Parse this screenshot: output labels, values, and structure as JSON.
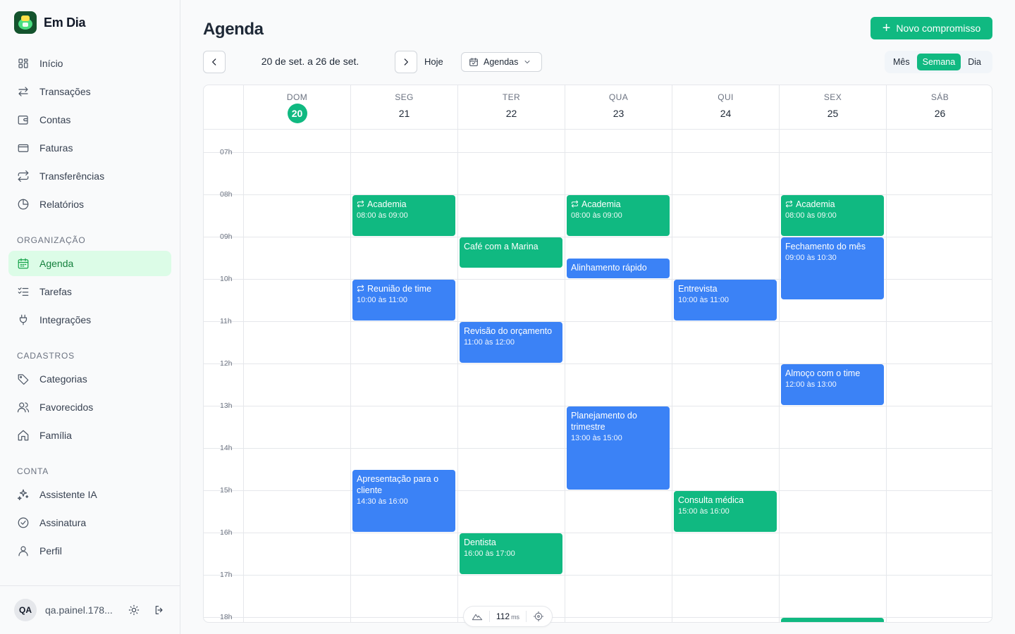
{
  "app": {
    "name": "Em Dia"
  },
  "sidebar": {
    "main_items": [
      {
        "label": "Início",
        "icon": "grid-icon"
      },
      {
        "label": "Transações",
        "icon": "arrows-left-right-icon"
      },
      {
        "label": "Contas",
        "icon": "wallet-icon"
      },
      {
        "label": "Faturas",
        "icon": "credit-card-icon"
      },
      {
        "label": "Transferências",
        "icon": "repeat-icon"
      },
      {
        "label": "Relatórios",
        "icon": "pie-chart-icon"
      }
    ],
    "sections": [
      {
        "label": "Organização",
        "items": [
          {
            "label": "Agenda",
            "icon": "calendar-icon",
            "active": true
          },
          {
            "label": "Tarefas",
            "icon": "list-checks-icon"
          },
          {
            "label": "Integrações",
            "icon": "plug-icon"
          }
        ]
      },
      {
        "label": "Cadastros",
        "items": [
          {
            "label": "Categorias",
            "icon": "tag-icon"
          },
          {
            "label": "Favorecidos",
            "icon": "users-icon"
          },
          {
            "label": "Família",
            "icon": "home-icon"
          }
        ]
      },
      {
        "label": "Conta",
        "items": [
          {
            "label": "Assistente IA",
            "icon": "sparkles-icon"
          },
          {
            "label": "Assinatura",
            "icon": "check-circle-icon"
          },
          {
            "label": "Perfil",
            "icon": "user-icon"
          }
        ]
      }
    ],
    "user": {
      "initials": "QA",
      "email": "qa.painel.178..."
    }
  },
  "header": {
    "title": "Agenda",
    "new_button": "Novo compromisso",
    "date_range": "20 de set. a 26 de set.",
    "today": "Hoje",
    "calendars_filter": "Agendas",
    "views": [
      {
        "label": "Mês",
        "active": false
      },
      {
        "label": "Semana",
        "active": true
      },
      {
        "label": "Dia",
        "active": false
      }
    ]
  },
  "calendar": {
    "days": [
      {
        "dow": "DOM",
        "num": "20",
        "today": true
      },
      {
        "dow": "SEG",
        "num": "21"
      },
      {
        "dow": "TER",
        "num": "22"
      },
      {
        "dow": "QUA",
        "num": "23"
      },
      {
        "dow": "QUI",
        "num": "24"
      },
      {
        "dow": "SEX",
        "num": "25"
      },
      {
        "dow": "SÁB",
        "num": "26"
      }
    ],
    "hours": [
      "07h",
      "08h",
      "09h",
      "10h",
      "11h",
      "12h",
      "13h",
      "14h",
      "15h",
      "16h",
      "17h",
      "18h"
    ],
    "events": [
      {
        "day": 1,
        "title": "Academia",
        "time": "08:00 às 09:00",
        "start": 8,
        "end": 9,
        "color": "green",
        "recurring": true
      },
      {
        "day": 3,
        "title": "Academia",
        "time": "08:00 às 09:00",
        "start": 8,
        "end": 9,
        "color": "green",
        "recurring": true
      },
      {
        "day": 5,
        "title": "Academia",
        "time": "08:00 às 09:00",
        "start": 8,
        "end": 9,
        "color": "green",
        "recurring": true
      },
      {
        "day": 2,
        "title": "Café com a Marina",
        "time": "",
        "start": 9,
        "end": 9.75,
        "color": "green"
      },
      {
        "day": 5,
        "title": "Fechamento do mês",
        "time": "09:00 às 10:30",
        "start": 9,
        "end": 10.5,
        "color": "blue"
      },
      {
        "day": 3,
        "title": "Alinhamento rápido",
        "time": "",
        "start": 9.5,
        "end": 10,
        "color": "blue"
      },
      {
        "day": 1,
        "title": "Reunião de time",
        "time": "10:00 às 11:00",
        "start": 10,
        "end": 11,
        "color": "blue",
        "recurring": true
      },
      {
        "day": 4,
        "title": "Entrevista",
        "time": "10:00 às 11:00",
        "start": 10,
        "end": 11,
        "color": "blue"
      },
      {
        "day": 2,
        "title": "Revisão do orçamento",
        "time": "11:00 às 12:00",
        "start": 11,
        "end": 12,
        "color": "blue"
      },
      {
        "day": 5,
        "title": "Almoço com o time",
        "time": "12:00 às 13:00",
        "start": 12,
        "end": 13,
        "color": "blue"
      },
      {
        "day": 3,
        "title": "Planejamento do trimestre",
        "time": "13:00 às 15:00",
        "start": 13,
        "end": 15,
        "color": "blue"
      },
      {
        "day": 1,
        "title": "Apresentação para o cliente",
        "time": "14:30 às 16:00",
        "start": 14.5,
        "end": 16,
        "color": "blue"
      },
      {
        "day": 4,
        "title": "Consulta médica",
        "time": "15:00 às 16:00",
        "start": 15,
        "end": 16,
        "color": "green"
      },
      {
        "day": 2,
        "title": "Dentista",
        "time": "16:00 às 17:00",
        "start": 16,
        "end": 17,
        "color": "green"
      },
      {
        "day": 5,
        "title": "",
        "time": "",
        "start": 18,
        "end": 19,
        "color": "green"
      }
    ]
  },
  "perf": {
    "value": "112",
    "unit": "ms"
  },
  "colors": {
    "accent": "#10b981",
    "event_blue": "#3b82f6",
    "active_bg": "#dcfce7"
  }
}
